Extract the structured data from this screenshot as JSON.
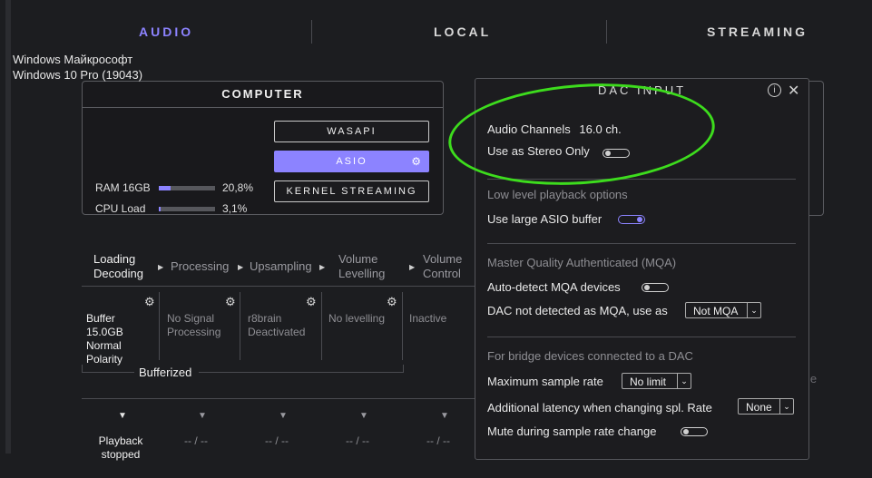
{
  "tabs": [
    {
      "label": "AUDIO"
    },
    {
      "label": "LOCAL"
    },
    {
      "label": "STREAMING"
    }
  ],
  "computer": {
    "title": "COMPUTER",
    "system_line1": "Windows Майкрософт",
    "system_line2": "Windows 10 Pro (19043)",
    "ram_label": "RAM 16GB",
    "ram_value": "20,8%",
    "ram_level": 0.208,
    "cpu_label": "CPU Load",
    "cpu_value": "3,1%",
    "cpu_level": 0.031,
    "buttons": {
      "wasapi": "WASAPI",
      "asio": "ASIO",
      "kernel": "KERNEL STREAMING"
    }
  },
  "pipeline": {
    "steps": [
      {
        "line1": "Loading",
        "line2": "Decoding"
      },
      {
        "line1": "Processing",
        "line2": ""
      },
      {
        "line1": "Upsampling",
        "line2": ""
      },
      {
        "line1": "Volume",
        "line2": "Levelling"
      },
      {
        "line1": "Volume",
        "line2": "Control"
      }
    ],
    "cols": [
      {
        "l1": "Buffer",
        "l2": "15.0GB",
        "l3": "Normal",
        "l4": "Polarity"
      },
      {
        "l1": "No Signal",
        "l2": "Processing",
        "l3": "",
        "l4": ""
      },
      {
        "l1": "r8brain",
        "l2": "Deactivated",
        "l3": "",
        "l4": ""
      },
      {
        "l1": "No levelling",
        "l2": "",
        "l3": "",
        "l4": ""
      },
      {
        "l1": "Inactive",
        "l2": "",
        "l3": "",
        "l4": ""
      }
    ],
    "group_label": "Bufferized",
    "playback_line1": "Playback",
    "playback_line2": "stopped",
    "placeholder": "-- / --",
    "partial_right": "le"
  },
  "dac": {
    "title": "DAC INPUT",
    "audio_channels_label": "Audio Channels",
    "audio_channels_value": "16.0 ch.",
    "stereo_only_label": "Use as Stereo Only",
    "stereo_only_on": false,
    "low_level_title": "Low level playback options",
    "large_asio_label": "Use large ASIO buffer",
    "large_asio_on": true,
    "mqa_title": "Master Quality Authenticated (MQA)",
    "auto_mqa_label": "Auto-detect MQA devices",
    "auto_mqa_on": false,
    "not_mqa_label": "DAC not detected as MQA, use as",
    "not_mqa_value": "Not MQA",
    "bridge_title": "For bridge devices connected to a DAC",
    "max_rate_label": "Maximum sample rate",
    "max_rate_value": "No limit",
    "latency_label": "Additional latency when changing spl. Rate",
    "latency_value": "None",
    "mute_label": "Mute during sample rate change",
    "mute_on": false
  },
  "colors": {
    "accent": "#8c83ff",
    "highlight": "#3ddc1d",
    "background": "#1c1d20"
  }
}
